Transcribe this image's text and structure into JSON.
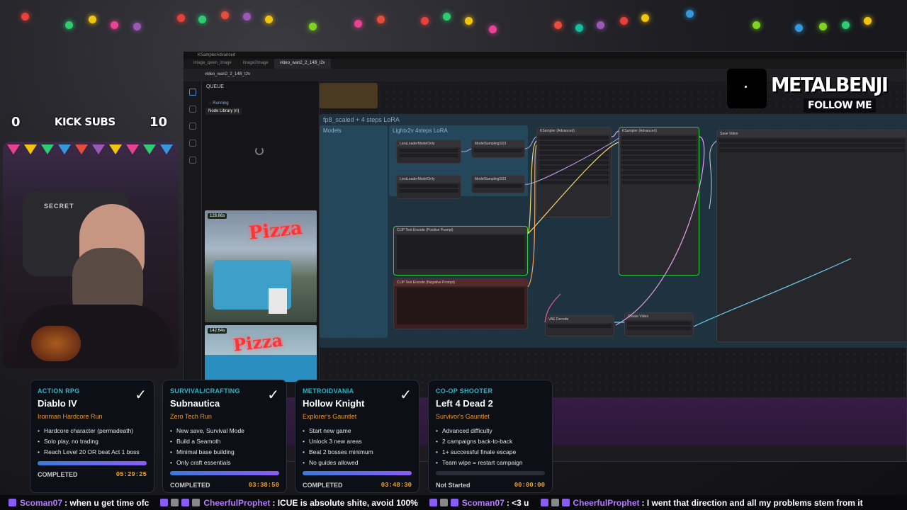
{
  "overlay": {
    "subs": {
      "left": "0",
      "label": "KICK SUBS",
      "right": "10"
    },
    "brand": {
      "name": "METALBENJI",
      "follow": "FOLLOW ME"
    }
  },
  "comfy": {
    "window_title": "KSamplerAdvanced",
    "tabs": [
      "image_qwen_image",
      "image2image",
      "video_wan2_2_14B_t2v"
    ],
    "active_tab_index": 2,
    "workflow_name": "video_wan2_2_14B_t2v",
    "queue_title": "QUEUE",
    "running_label": "Running",
    "tooltip": "Node Library (n)",
    "thumbs": [
      {
        "badge": "128.66s",
        "sign": "Pizza"
      },
      {
        "badge": "142.64s",
        "sign": "Pizza"
      }
    ],
    "groups": {
      "main": "fp8_scaled + 4 steps LoRA",
      "models": "Models",
      "lightx": "Lightx2v 4steps LoRA"
    },
    "nodes": {
      "lora1": "LoraLoaderModelOnly",
      "lora2": "LoraLoaderModelOnly",
      "ms1": "ModelSamplingSD3",
      "ms2": "ModelSamplingSD3",
      "ks1": "KSampler (Advanced)",
      "ks2": "KSampler (Advanced)",
      "save": "Save Video",
      "clip_pos": "CLIP Text Encode (Positive Prompt)",
      "clip_neg": "CLIP Text Encode (Negative Prompt)",
      "vae": "VAE Decode",
      "create": "Create Video"
    }
  },
  "cards": [
    {
      "genre": "ACTION RPG",
      "game": "Diablo IV",
      "variant": "Ironman Hardcore Run",
      "rules": [
        "Hardcore character (permadeath)",
        "Solo play, no trading",
        "Reach Level 20 OR beat Act 1 boss"
      ],
      "status": "COMPLETED",
      "time": "05:29:25",
      "progress": 1.0,
      "checked": true
    },
    {
      "genre": "SURVIVAL/CRAFTING",
      "game": "Subnautica",
      "variant": "Zero Tech Run",
      "rules": [
        "New save, Survival Mode",
        "Build a Seamoth",
        "Minimal base building",
        "Only craft essentials"
      ],
      "status": "COMPLETED",
      "time": "03:38:50",
      "progress": 1.0,
      "checked": true
    },
    {
      "genre": "METROIDVANIA",
      "game": "Hollow Knight",
      "variant": "Explorer's Gauntlet",
      "rules": [
        "Start new game",
        "Unlock 3 new areas",
        "Beat 2 bosses minimum",
        "No guides allowed"
      ],
      "status": "COMPLETED",
      "time": "03:48:30",
      "progress": 1.0,
      "checked": true
    },
    {
      "genre": "CO-OP SHOOTER",
      "game": "Left 4 Dead 2",
      "variant": "Survivor's Gauntlet",
      "rules": [
        "Advanced difficulty",
        "2 campaigns back-to-back",
        "1+ successful finale escape",
        "Team wipe = restart campaign"
      ],
      "status": "Not Started",
      "time": "00:00:00",
      "progress": 0,
      "checked": false
    }
  ],
  "chat": [
    {
      "user": "Scoman07",
      "msg": ": when u get time ofc"
    },
    {
      "user": "CheerfulProphet",
      "msg": ": ICUE is absolute shite, avoid 100%"
    },
    {
      "user": "Scoman07",
      "msg": ": <3 u"
    },
    {
      "user": "CheerfulProphet",
      "msg": ": I went that direction and all my problems stem from it"
    }
  ],
  "colors": {
    "accent": "#2ab7c9",
    "variant": "#e8962b",
    "time": "#f0a020",
    "chat_user": "#b57bff"
  }
}
